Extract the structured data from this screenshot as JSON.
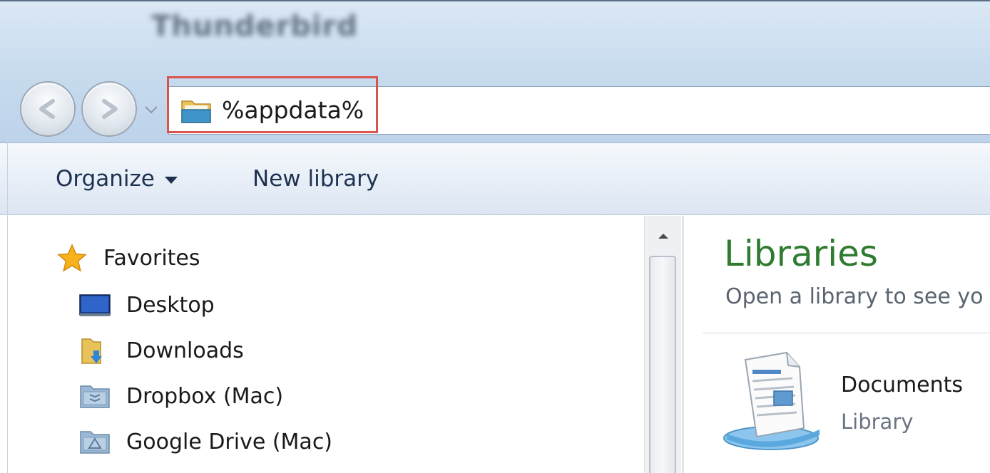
{
  "window": {
    "title": "Thunderbird"
  },
  "address": {
    "path": "%appdata%",
    "highlight_color": "#d9534f"
  },
  "toolbar": {
    "organize_label": "Organize",
    "new_library_label": "New library"
  },
  "navigation": {
    "favorites_label": "Favorites",
    "items": [
      {
        "label": "Desktop",
        "icon": "desktop-icon"
      },
      {
        "label": "Downloads",
        "icon": "downloads-folder-icon"
      },
      {
        "label": "Dropbox (Mac)",
        "icon": "dropbox-folder-icon"
      },
      {
        "label": "Google Drive (Mac)",
        "icon": "google-drive-folder-icon"
      }
    ]
  },
  "content": {
    "title": "Libraries",
    "subtitle": "Open a library to see yo",
    "items": [
      {
        "name": "Documents",
        "type": "Library",
        "icon": "documents-library-icon"
      }
    ]
  },
  "colors": {
    "accent_green": "#2f7b2f",
    "toolbar_text": "#1e3250"
  }
}
